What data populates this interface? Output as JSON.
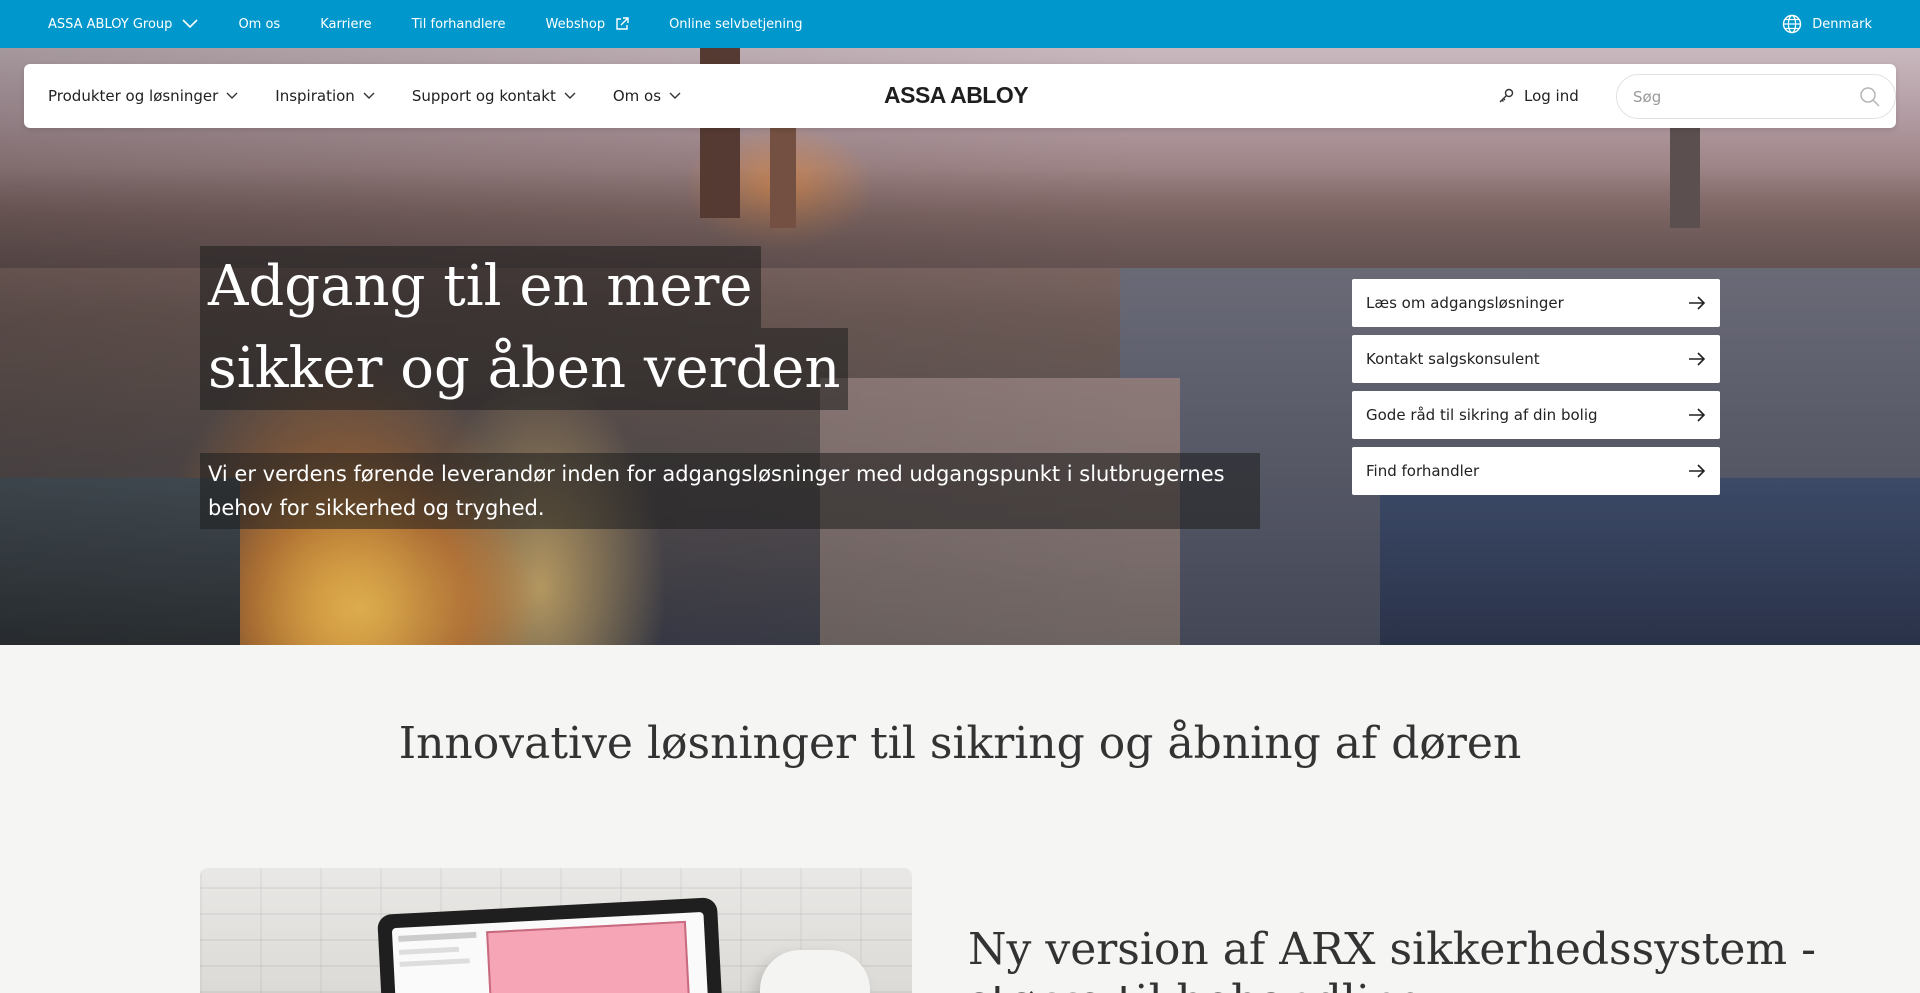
{
  "topbar": {
    "links": [
      {
        "label": "ASSA ABLOY Group",
        "icon": "chevron-down-icon"
      },
      {
        "label": "Om os"
      },
      {
        "label": "Karriere"
      },
      {
        "label": "Til forhandlere"
      },
      {
        "label": "Webshop",
        "icon": "external-link-icon"
      },
      {
        "label": "Online selvbetjening"
      }
    ],
    "country": "Denmark",
    "country_icon": "globe-icon",
    "bg_color": "#0098cc"
  },
  "nav": {
    "items": [
      {
        "label": "Produkter og løsninger"
      },
      {
        "label": "Inspiration"
      },
      {
        "label": "Support og kontakt"
      },
      {
        "label": "Om os"
      }
    ],
    "logo": "ASSA ABLOY",
    "login": "Log ind",
    "login_icon": "key-icon",
    "search": {
      "placeholder": "Søg",
      "value": "",
      "icon": "search-icon"
    }
  },
  "hero": {
    "title_line1": "Adgang til en mere",
    "title_line2": "sikker og åben verden",
    "subtitle": "Vi er verdens førende leverandør inden for adgangsløsninger med udgangspunkt i slutbrugernes behov for sikkerhed og tryghed.",
    "quick_links": [
      {
        "label": "Læs om adgangsløsninger",
        "icon": "arrow-right-icon"
      },
      {
        "label": "Kontakt salgskonsulent",
        "icon": "arrow-right-icon"
      },
      {
        "label": "Gode råd til sikring af din bolig",
        "icon": "arrow-right-icon"
      },
      {
        "label": "Find forhandler",
        "icon": "arrow-right-icon"
      }
    ]
  },
  "section": {
    "title": "Innovative løsninger til sikring og åbning af døren"
  },
  "news": {
    "headline_line1": "Ny version af ARX sikkerhedssystem -",
    "headline_line2": "større til        behandling"
  }
}
